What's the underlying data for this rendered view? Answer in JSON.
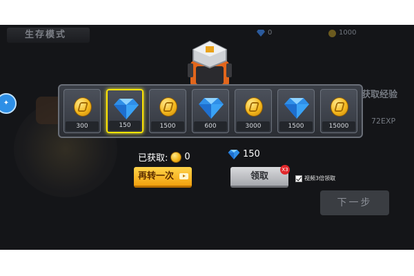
{
  "header": {
    "mode_title": "生存模式",
    "gem_balance": "0",
    "coin_balance": "1000"
  },
  "side": {
    "right_label": "获取经验",
    "right_exp": "72EXP",
    "next_button": "下一步"
  },
  "rewards": [
    {
      "type": "coin",
      "amount": "300",
      "selected": false
    },
    {
      "type": "gem",
      "amount": "150",
      "selected": true
    },
    {
      "type": "coin",
      "amount": "1500",
      "selected": false
    },
    {
      "type": "gem",
      "amount": "600",
      "selected": false
    },
    {
      "type": "coin",
      "amount": "3000",
      "selected": false
    },
    {
      "type": "gem",
      "amount": "1500",
      "selected": false
    },
    {
      "type": "coin",
      "amount": "15000",
      "selected": false
    }
  ],
  "obtained": {
    "label": "已获取:",
    "coins": "0",
    "gems": "150"
  },
  "buttons": {
    "spin_again": "再转一次",
    "claim": "领取",
    "claim_badge": "X3"
  },
  "checkbox": {
    "label": "视频3倍领取",
    "checked": true
  },
  "colors": {
    "selected_border": "#ffe600",
    "spin_button": "#f2a20f",
    "claim_button": "#a6a8ad",
    "badge": "#e0272b"
  }
}
